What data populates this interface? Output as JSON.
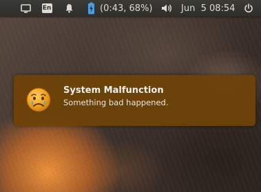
{
  "topbar": {
    "language": "En",
    "battery_status": "(0:43, 68%)",
    "datetime": "Jun  5 08:54"
  },
  "icons": {
    "display": "display-icon",
    "keyboard": "keyboard-layout-icon",
    "notifications": "bell-icon",
    "battery": "battery-charging-icon",
    "volume": "speaker-icon",
    "power": "power-icon",
    "notification": "crying-face-icon"
  },
  "notification": {
    "title": "System Malfunction",
    "body": "Something bad happened."
  },
  "colors": {
    "panel": "#2f2e2b",
    "panel_text": "#dfdbd2",
    "battery_accent": "#4a9ee8",
    "bubble": "#6e4208",
    "emoji_face": "#f0a020",
    "tear": "#4aa3e6"
  }
}
